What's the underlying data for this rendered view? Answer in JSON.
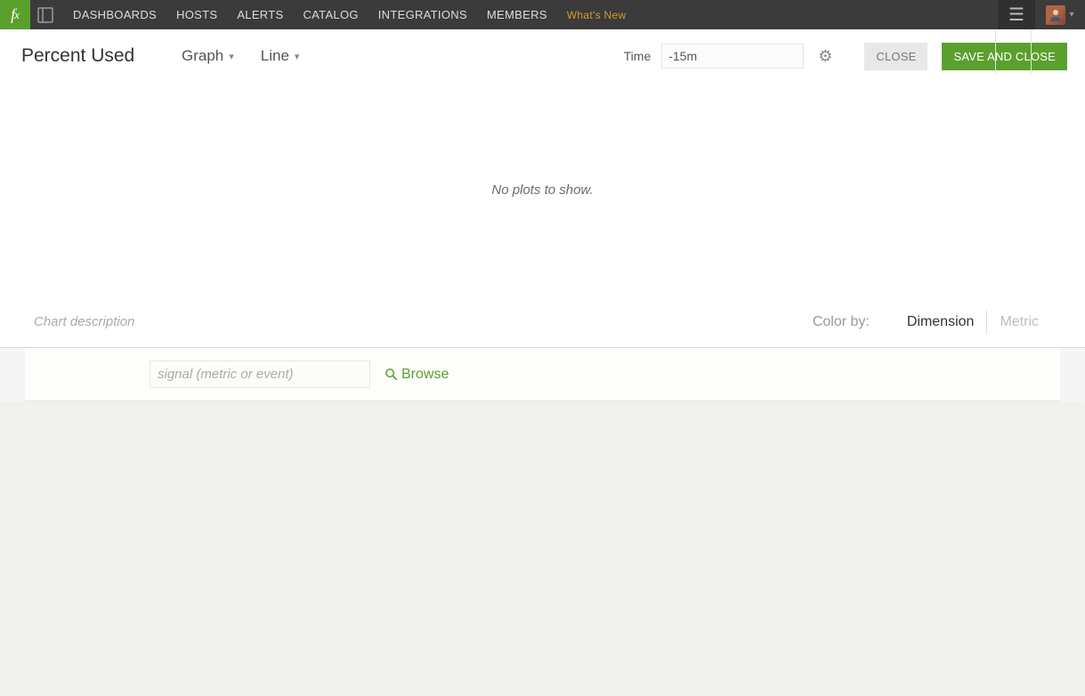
{
  "nav": {
    "dashboards": "DASHBOARDS",
    "hosts": "HOSTS",
    "alerts": "ALERTS",
    "catalog": "CATALOG",
    "integrations": "INTEGRATIONS",
    "members": "MEMBERS",
    "whatsnew": "What's New"
  },
  "toolbar": {
    "chart_title": "Percent Used",
    "viz_type": "Graph",
    "chart_type": "Line",
    "time_label": "Time",
    "time_value": "-15m",
    "close_label": "CLOSE",
    "save_label": "SAVE AND CLOSE"
  },
  "plot": {
    "empty_message": "No plots to show."
  },
  "desc": {
    "placeholder": "Chart description",
    "colorby_label": "Color by:",
    "dimension": "Dimension",
    "metric": "Metric"
  },
  "signal": {
    "placeholder": "signal (metric or event)",
    "browse": "Browse"
  }
}
